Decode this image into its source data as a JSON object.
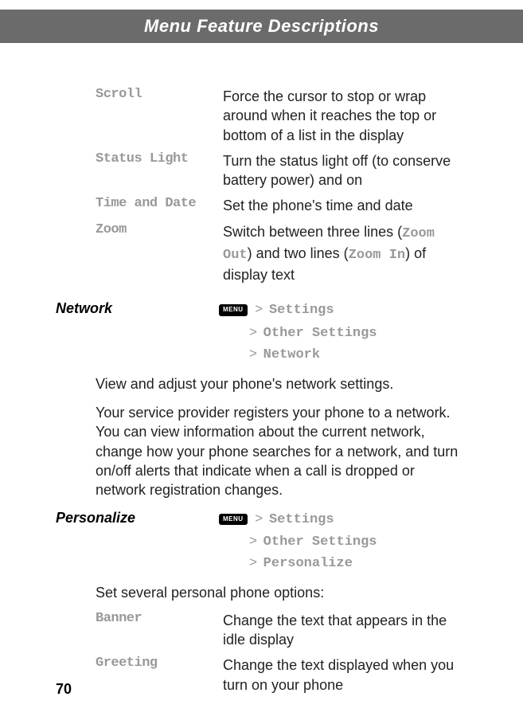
{
  "header": "Menu Feature Descriptions",
  "topOptions": [
    {
      "term": "Scroll",
      "desc": "Force the cursor to stop or wrap around when it reaches the top or bottom of a list in the display"
    },
    {
      "term": "Status Light",
      "desc": "Turn the status light off (to conserve battery power) and on"
    },
    {
      "term": "Time and Date",
      "desc": "Set the phone's time and date"
    }
  ],
  "zoom": {
    "term": "Zoom",
    "descPrefix": "Switch between three lines (",
    "opt1": "Zoom Out",
    "descMid": ") and two lines (",
    "opt2": "Zoom In",
    "descSuffix": ") of display text"
  },
  "network": {
    "title": "Network",
    "menuLabel": "MENU",
    "path1": "Settings",
    "path2": "Other Settings",
    "path3": "Network",
    "body1": "View and adjust your phone's network settings.",
    "body2": "Your service provider registers your phone to a network. You can view information about the current network, change how your phone searches for a network, and turn on/off alerts that indicate when a call is dropped or network registration changes."
  },
  "personalize": {
    "title": "Personalize",
    "menuLabel": "MENU",
    "path1": "Settings",
    "path2": "Other Settings",
    "path3": "Personalize",
    "body1": "Set several personal phone options:",
    "options": [
      {
        "term": "Banner",
        "desc": "Change the text that appears in the idle display"
      },
      {
        "term": "Greeting",
        "desc": "Change the text displayed when you turn on your phone"
      }
    ]
  },
  "pageNumber": "70",
  "sep": ">"
}
